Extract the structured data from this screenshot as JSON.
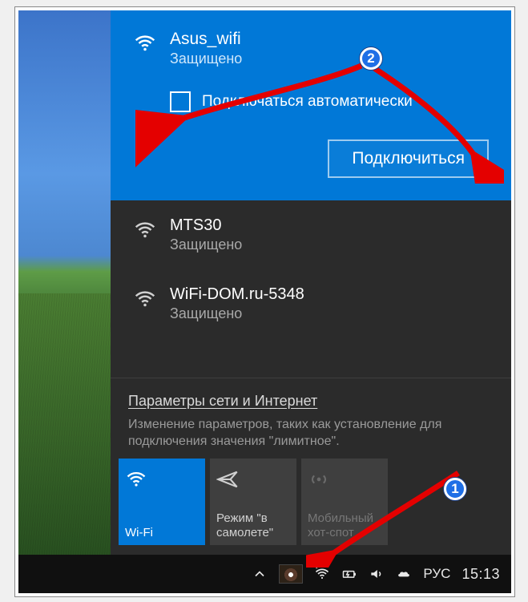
{
  "selected_network": {
    "name": "Asus_wifi",
    "status": "Защищено",
    "auto_connect_label": "Подключаться автоматически",
    "connect_label": "Подключиться"
  },
  "networks": [
    {
      "name": "MTS30",
      "status": "Защищено"
    },
    {
      "name": "WiFi-DOM.ru-5348",
      "status": "Защищено"
    }
  ],
  "settings": {
    "link": "Параметры сети и Интернет",
    "description": "Изменение параметров, таких как установление для подключения значения \"лимитное\"."
  },
  "tiles": {
    "wifi": "Wi-Fi",
    "airplane": "Режим \"в самолете\"",
    "hotspot": "Мобильный хот-спот"
  },
  "tray": {
    "lang": "РУС",
    "clock": "15:13"
  },
  "badges": {
    "step1": "1",
    "step2": "2"
  }
}
